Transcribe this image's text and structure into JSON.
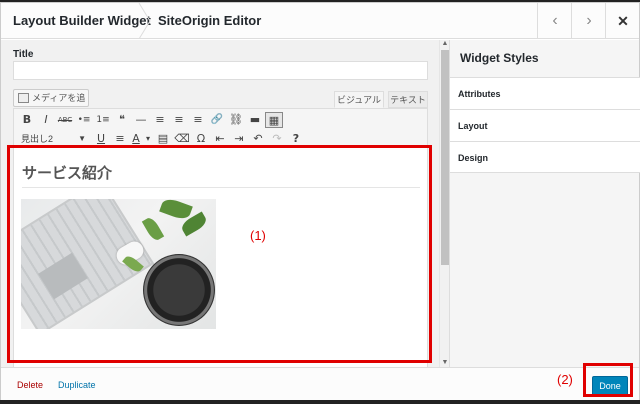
{
  "header": {
    "crumb_1": "Layout Builder Widget",
    "crumb_2": "SiteOrigin Editor",
    "prev_icon": "‹",
    "next_icon": "›",
    "close_icon": "✕"
  },
  "form": {
    "title_label": "Title",
    "title_value": "",
    "media_button": "メディアを追加",
    "tab_visual": "ビジュアル",
    "tab_text": "テキスト",
    "format_select": "見出し2"
  },
  "toolbar": {
    "row1": [
      "B",
      "I",
      "ABC",
      "•≡",
      "1≡",
      "❝",
      "—",
      "≡",
      "≡",
      "≡",
      "🔗",
      "⛓",
      "▬",
      "▦"
    ],
    "row2": [
      "U",
      "≡",
      "A",
      "▾",
      "▤",
      "⌫",
      "Ω",
      "⇤",
      "⇥",
      "↶",
      "↷",
      "?"
    ]
  },
  "editor": {
    "heading": "サービス紹介"
  },
  "sidebar": {
    "title": "Widget Styles",
    "sections": [
      "Attributes",
      "Layout",
      "Design"
    ]
  },
  "footer": {
    "delete": "Delete",
    "duplicate": "Duplicate",
    "done": "Done"
  },
  "annotations": {
    "label_1": "(1)",
    "label_2": "(2)",
    "color": "#e00000"
  },
  "colors": {
    "accent": "#0085ba",
    "delete": "#aa0000",
    "link": "#0073aa"
  }
}
